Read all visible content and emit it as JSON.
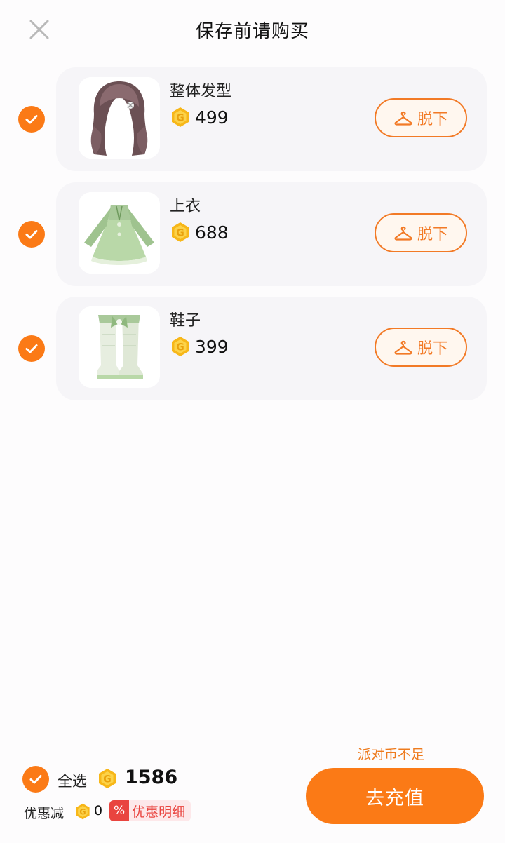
{
  "header": {
    "title": "保存前请购买",
    "close_icon": "close-icon"
  },
  "items": [
    {
      "name": "整体发型",
      "price": "499",
      "remove_label": "脱下",
      "checked": true,
      "thumb": "hair-image"
    },
    {
      "name": "上衣",
      "price": "688",
      "remove_label": "脱下",
      "checked": true,
      "thumb": "dress-image"
    },
    {
      "name": "鞋子",
      "price": "399",
      "remove_label": "脱下",
      "checked": true,
      "thumb": "boots-image"
    }
  ],
  "footer": {
    "insufficient_text": "派对币不足",
    "select_all_label": "全选",
    "total": "1586",
    "discount_label": "优惠减",
    "discount_value": "0",
    "discount_badge": "%",
    "discount_detail": "优惠明细",
    "recharge_label": "去充值"
  },
  "colors": {
    "accent": "#fb7a16",
    "accent_text": "#f27a26",
    "coin": "#f7b719",
    "discount_red": "#e9443f",
    "card_bg": "#f6f5f8"
  }
}
